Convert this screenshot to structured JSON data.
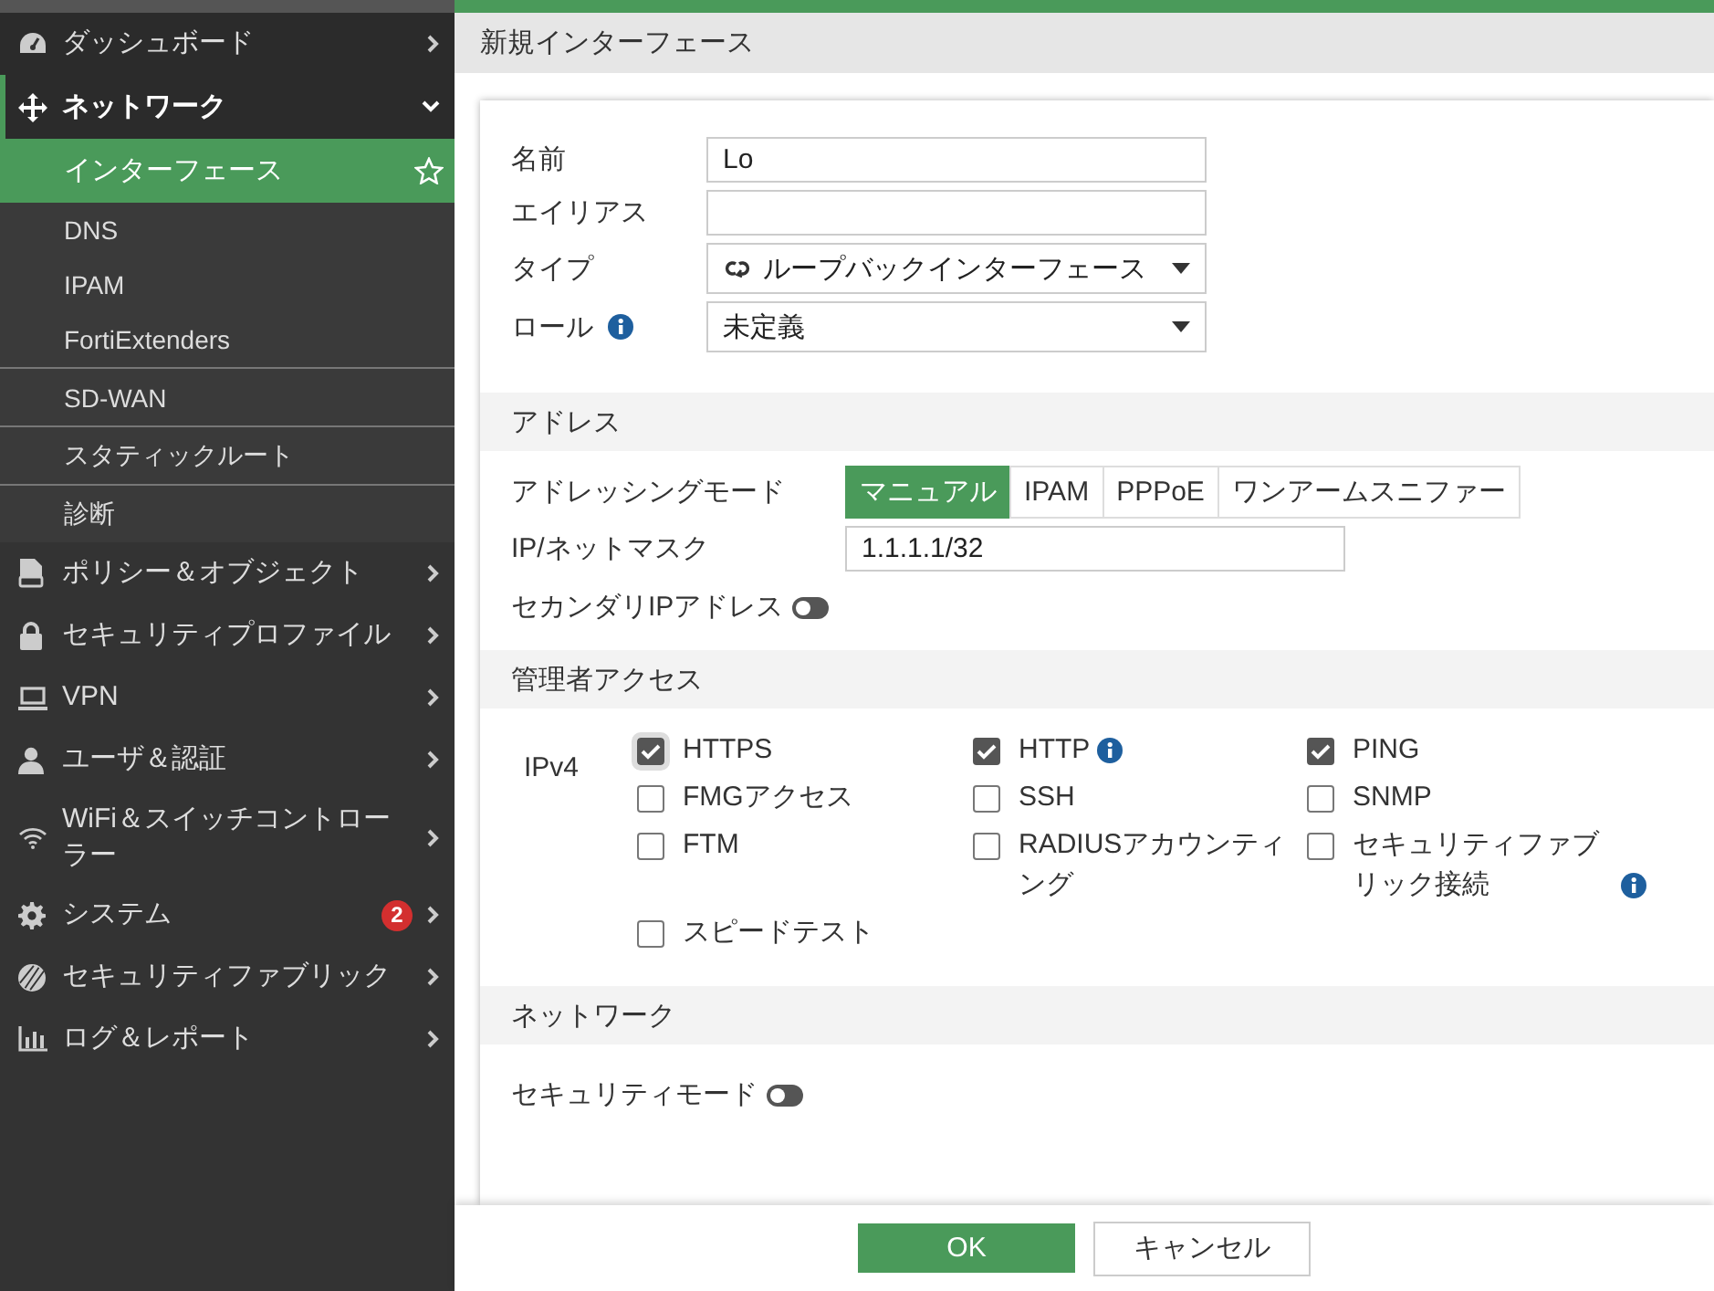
{
  "sidebar": {
    "items": [
      {
        "label": "ダッシュボード",
        "expanded": false
      },
      {
        "label": "ネットワーク",
        "expanded": true,
        "children": [
          {
            "label": "インターフェース",
            "selected": true
          },
          {
            "label": "DNS",
            "selected": false
          },
          {
            "label": "IPAM",
            "selected": false
          },
          {
            "label": "FortiExtenders",
            "selected": false
          },
          {
            "label": "SD-WAN",
            "selected": false
          },
          {
            "label": "スタティックルート",
            "selected": false
          },
          {
            "label": "診断",
            "selected": false
          }
        ]
      },
      {
        "label": "ポリシー＆オブジェクト",
        "expanded": false
      },
      {
        "label": "セキュリティプロファイル",
        "expanded": false
      },
      {
        "label": "VPN",
        "expanded": false
      },
      {
        "label": "ユーザ＆認証",
        "expanded": false
      },
      {
        "label": "WiFi＆スイッチコントローラー",
        "expanded": false
      },
      {
        "label": "システム",
        "expanded": false,
        "badge": "2"
      },
      {
        "label": "セキュリティファブリック",
        "expanded": false
      },
      {
        "label": "ログ＆レポート",
        "expanded": false
      }
    ]
  },
  "page": {
    "title": "新規インターフェース"
  },
  "fields": [
    {
      "label": "名前",
      "kind": "text",
      "value": "Lo"
    },
    {
      "label": "エイリアス",
      "kind": "text"
    },
    {
      "label": "タイプ",
      "kind": "icon-select",
      "value": "ループバックインターフェース"
    },
    {
      "label": "ロール",
      "kind": "select",
      "value": "未定義",
      "info": true
    }
  ],
  "address": {
    "title": "アドレス",
    "mode_label": "アドレッシングモード",
    "modes": [
      {
        "label": "マニュアル",
        "selected": true
      },
      {
        "label": "IPAM",
        "selected": false
      },
      {
        "label": "PPPoE",
        "selected": false
      },
      {
        "label": "ワンアームスニファー",
        "selected": false
      }
    ],
    "ip_label": "IP/ネットマスク",
    "ip_value": "1.1.1.1/32",
    "secondary": {
      "label": "セカンダリIPアドレス",
      "on": false
    }
  },
  "admin_access": {
    "title": "管理者アクセス",
    "label": "IPv4",
    "options": [
      {
        "label": "HTTPS",
        "checked": true
      },
      {
        "label": "HTTP",
        "checked": true,
        "info": true
      },
      {
        "label": "PING",
        "checked": true
      },
      {
        "label": "FMGアクセス",
        "checked": false
      },
      {
        "label": "SSH",
        "checked": false
      },
      {
        "label": "SNMP",
        "checked": false
      },
      {
        "label": "FTM",
        "checked": false
      },
      {
        "label": "RADIUSアカウンティング",
        "checked": false
      },
      {
        "label": "セキュリティファブリック接続",
        "checked": false,
        "info": true
      },
      {
        "label": "スピードテスト",
        "checked": false
      }
    ]
  },
  "network": {
    "title": "ネットワーク",
    "security_mode": {
      "label": "セキュリティモード",
      "on": false
    }
  },
  "buttons": [
    {
      "label": "OK",
      "kind": "primary"
    },
    {
      "label": "キャンセル",
      "kind": "secondary"
    }
  ]
}
